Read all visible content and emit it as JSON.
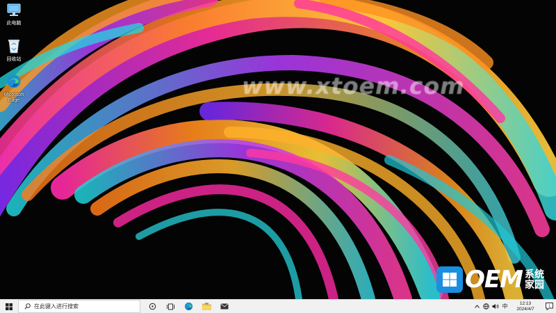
{
  "desktop": {
    "watermark": "www.xtoem.com",
    "icons": [
      {
        "label": "此电脑",
        "icon": "computer-icon"
      },
      {
        "label": "回收站",
        "icon": "recycle-bin-icon"
      },
      {
        "label": "Microsoft Edge",
        "icon": "edge-icon"
      }
    ],
    "logo": {
      "text": "OEM",
      "sub_line1": "系统",
      "sub_line2": "家园",
      "color": "#1a8fe0"
    }
  },
  "taskbar": {
    "search_placeholder": "在此键入进行搜索",
    "buttons": [
      "task-view-icon",
      "multitask-icon",
      "edge-icon",
      "file-explorer-icon",
      "mail-icon"
    ],
    "tray": {
      "ime": "中",
      "time": "12:13",
      "date": "2024/4/7",
      "notification_count": "1"
    }
  }
}
